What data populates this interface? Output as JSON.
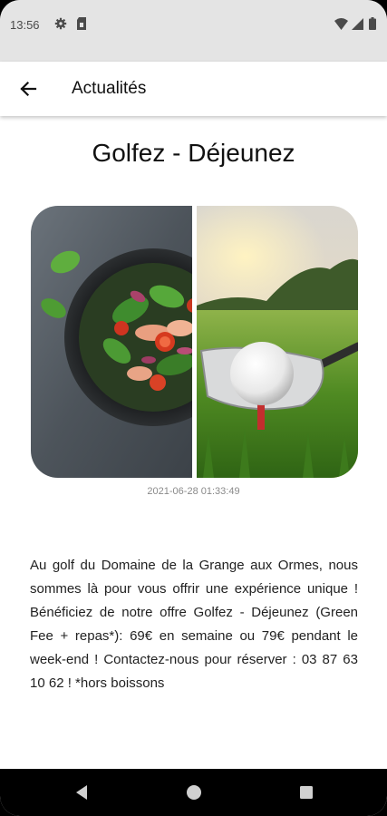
{
  "status_bar": {
    "time": "13:56",
    "icons": [
      "gear-icon",
      "sim-card-icon",
      "wifi-icon",
      "signal-icon",
      "battery-icon"
    ]
  },
  "app_bar": {
    "back_icon": "arrow-left-icon",
    "title": "Actualités"
  },
  "article": {
    "title": "Golfez - Déjeunez",
    "image_description_icons": [
      "salad-bowl",
      "golf-ball"
    ],
    "timestamp": "2021-06-28 01:33:49",
    "body": "Au golf du Domaine de la Grange aux Ormes, nous sommes là pour vous offrir une expérience unique ! Bénéficiez de notre offre Golfez - Déjeunez (Green Fee + repas*): 69€ en semaine ou 79€ pendant le week-end ! Contactez-nous pour réserver : 03 87 63 10 62 ! *hors boissons"
  },
  "nav_bar": {
    "buttons": [
      "back-triangle-icon",
      "home-circle-icon",
      "recents-square-icon"
    ]
  },
  "colors": {
    "status_bar_bg": "#e4e4e4",
    "app_bar_bg": "#ffffff",
    "text_primary": "#111111",
    "timestamp": "#8a8a8a",
    "nav_bar_bg": "#000000"
  }
}
